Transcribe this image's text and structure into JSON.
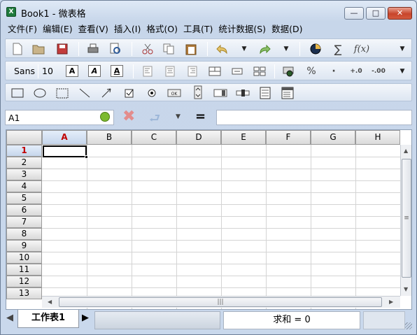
{
  "window": {
    "title": "Book1 - 微表格",
    "app_icon_letter": "X",
    "min_glyph": "—",
    "max_glyph": "□",
    "close_glyph": "✕"
  },
  "menu": [
    "文件(F)",
    "编辑(E)",
    "查看(V)",
    "插入(I)",
    "格式(O)",
    "工具(T)",
    "统计数据(S)",
    "数据(D)"
  ],
  "toolbar_format": {
    "font": "Sans",
    "size": "10",
    "bold_label": "A",
    "italic_label": "A",
    "underline_label": "A"
  },
  "formula_bar": {
    "cell_ref": "A1",
    "formula_value": "",
    "equals_label": "="
  },
  "sheet": {
    "columns": [
      "A",
      "B",
      "C",
      "D",
      "E",
      "F",
      "G",
      "H"
    ],
    "rows": [
      "1",
      "2",
      "3",
      "4",
      "5",
      "6",
      "7",
      "8",
      "9",
      "10",
      "11",
      "12",
      "13"
    ],
    "active_column": "A",
    "active_row": "1"
  },
  "tabs": {
    "active": "工作表1"
  },
  "status": {
    "sum_text": "求和 = 0"
  },
  "colors": {
    "active_header_text": "#c00000",
    "grid_line": "#d4d4d4",
    "window_bg": "#c9d8ec"
  }
}
